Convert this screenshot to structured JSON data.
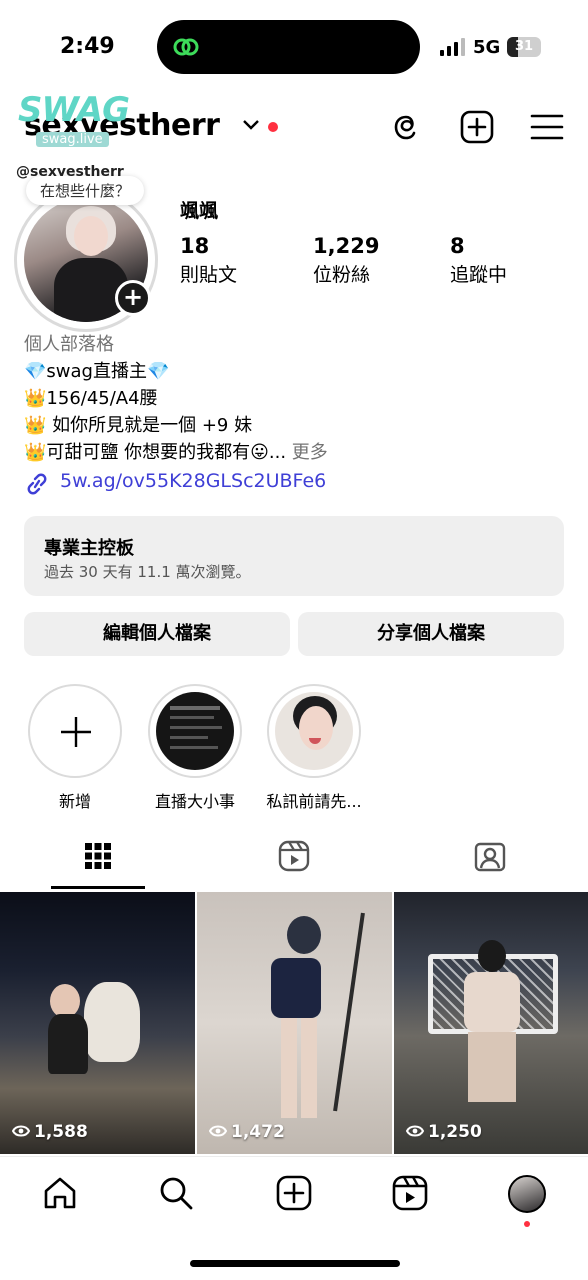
{
  "status_bar": {
    "time": "2:49",
    "network": "5G",
    "battery": "31",
    "battery_level": 0.31
  },
  "header": {
    "username": "sexyestherr"
  },
  "watermark": {
    "title": "SWAG",
    "site": "swag.live",
    "handle": "@sexyestherr"
  },
  "profile": {
    "note": "在想些什麼？",
    "display_name": "颯颯",
    "stats": [
      {
        "value": "18",
        "label": "則貼文"
      },
      {
        "value": "1,229",
        "label": "位粉絲"
      },
      {
        "value": "8",
        "label": "追蹤中"
      }
    ],
    "bio": {
      "category": "個人部落格",
      "lines": [
        "💎swag直播主💎",
        "👑156/45/A4腰",
        "👑 如你所見就是一個 +9 妹",
        "👑可甜可鹽 你想要的我都有😛..."
      ],
      "more": "更多",
      "link": "5w.ag/ov55K28GLSc2UBFe6"
    }
  },
  "dashboard": {
    "title": "專業主控板",
    "subtitle": "過去 30 天有 11.1 萬次瀏覽。"
  },
  "buttons": {
    "edit": "編輯個人檔案",
    "share": "分享個人檔案"
  },
  "highlights": [
    {
      "label": "新增"
    },
    {
      "label": "直播大小事"
    },
    {
      "label": "私訊前請先..."
    }
  ],
  "posts": [
    {
      "views": "1,588"
    },
    {
      "views": "1,472"
    },
    {
      "views": "1,250"
    }
  ],
  "colors": {
    "link": "#3f3fd6",
    "notification_dot": "#ff3040",
    "button_bg": "#efefef",
    "watermark": "#5fd6c6"
  }
}
